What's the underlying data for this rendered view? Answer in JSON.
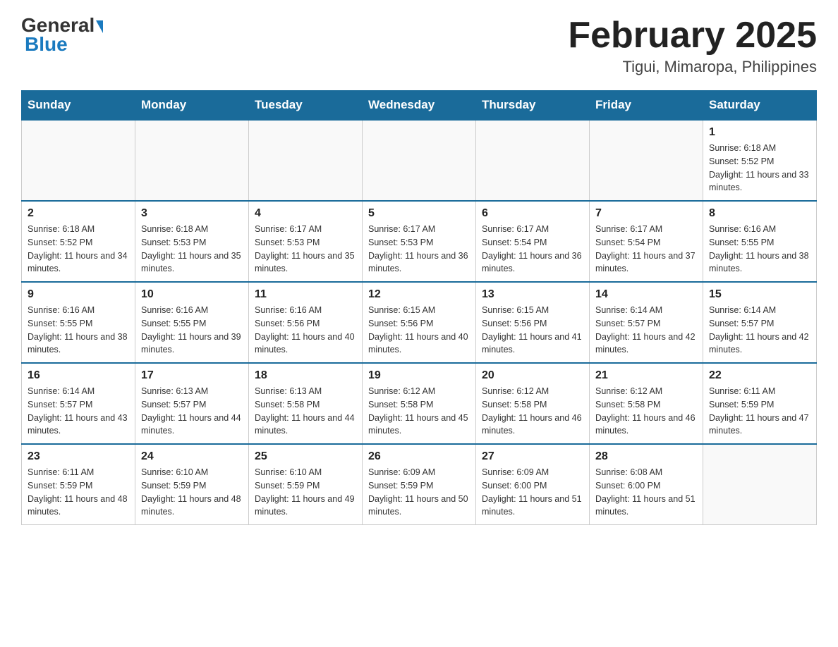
{
  "header": {
    "logo": {
      "general": "General",
      "blue": "Blue"
    },
    "title": "February 2025",
    "location": "Tigui, Mimaropa, Philippines"
  },
  "calendar": {
    "days_of_week": [
      "Sunday",
      "Monday",
      "Tuesday",
      "Wednesday",
      "Thursday",
      "Friday",
      "Saturday"
    ],
    "weeks": [
      {
        "days": [
          {
            "number": "",
            "sunrise": "",
            "sunset": "",
            "daylight": "",
            "empty": true
          },
          {
            "number": "",
            "sunrise": "",
            "sunset": "",
            "daylight": "",
            "empty": true
          },
          {
            "number": "",
            "sunrise": "",
            "sunset": "",
            "daylight": "",
            "empty": true
          },
          {
            "number": "",
            "sunrise": "",
            "sunset": "",
            "daylight": "",
            "empty": true
          },
          {
            "number": "",
            "sunrise": "",
            "sunset": "",
            "daylight": "",
            "empty": true
          },
          {
            "number": "",
            "sunrise": "",
            "sunset": "",
            "daylight": "",
            "empty": true
          },
          {
            "number": "1",
            "sunrise": "Sunrise: 6:18 AM",
            "sunset": "Sunset: 5:52 PM",
            "daylight": "Daylight: 11 hours and 33 minutes.",
            "empty": false
          }
        ]
      },
      {
        "days": [
          {
            "number": "2",
            "sunrise": "Sunrise: 6:18 AM",
            "sunset": "Sunset: 5:52 PM",
            "daylight": "Daylight: 11 hours and 34 minutes.",
            "empty": false
          },
          {
            "number": "3",
            "sunrise": "Sunrise: 6:18 AM",
            "sunset": "Sunset: 5:53 PM",
            "daylight": "Daylight: 11 hours and 35 minutes.",
            "empty": false
          },
          {
            "number": "4",
            "sunrise": "Sunrise: 6:17 AM",
            "sunset": "Sunset: 5:53 PM",
            "daylight": "Daylight: 11 hours and 35 minutes.",
            "empty": false
          },
          {
            "number": "5",
            "sunrise": "Sunrise: 6:17 AM",
            "sunset": "Sunset: 5:53 PM",
            "daylight": "Daylight: 11 hours and 36 minutes.",
            "empty": false
          },
          {
            "number": "6",
            "sunrise": "Sunrise: 6:17 AM",
            "sunset": "Sunset: 5:54 PM",
            "daylight": "Daylight: 11 hours and 36 minutes.",
            "empty": false
          },
          {
            "number": "7",
            "sunrise": "Sunrise: 6:17 AM",
            "sunset": "Sunset: 5:54 PM",
            "daylight": "Daylight: 11 hours and 37 minutes.",
            "empty": false
          },
          {
            "number": "8",
            "sunrise": "Sunrise: 6:16 AM",
            "sunset": "Sunset: 5:55 PM",
            "daylight": "Daylight: 11 hours and 38 minutes.",
            "empty": false
          }
        ]
      },
      {
        "days": [
          {
            "number": "9",
            "sunrise": "Sunrise: 6:16 AM",
            "sunset": "Sunset: 5:55 PM",
            "daylight": "Daylight: 11 hours and 38 minutes.",
            "empty": false
          },
          {
            "number": "10",
            "sunrise": "Sunrise: 6:16 AM",
            "sunset": "Sunset: 5:55 PM",
            "daylight": "Daylight: 11 hours and 39 minutes.",
            "empty": false
          },
          {
            "number": "11",
            "sunrise": "Sunrise: 6:16 AM",
            "sunset": "Sunset: 5:56 PM",
            "daylight": "Daylight: 11 hours and 40 minutes.",
            "empty": false
          },
          {
            "number": "12",
            "sunrise": "Sunrise: 6:15 AM",
            "sunset": "Sunset: 5:56 PM",
            "daylight": "Daylight: 11 hours and 40 minutes.",
            "empty": false
          },
          {
            "number": "13",
            "sunrise": "Sunrise: 6:15 AM",
            "sunset": "Sunset: 5:56 PM",
            "daylight": "Daylight: 11 hours and 41 minutes.",
            "empty": false
          },
          {
            "number": "14",
            "sunrise": "Sunrise: 6:14 AM",
            "sunset": "Sunset: 5:57 PM",
            "daylight": "Daylight: 11 hours and 42 minutes.",
            "empty": false
          },
          {
            "number": "15",
            "sunrise": "Sunrise: 6:14 AM",
            "sunset": "Sunset: 5:57 PM",
            "daylight": "Daylight: 11 hours and 42 minutes.",
            "empty": false
          }
        ]
      },
      {
        "days": [
          {
            "number": "16",
            "sunrise": "Sunrise: 6:14 AM",
            "sunset": "Sunset: 5:57 PM",
            "daylight": "Daylight: 11 hours and 43 minutes.",
            "empty": false
          },
          {
            "number": "17",
            "sunrise": "Sunrise: 6:13 AM",
            "sunset": "Sunset: 5:57 PM",
            "daylight": "Daylight: 11 hours and 44 minutes.",
            "empty": false
          },
          {
            "number": "18",
            "sunrise": "Sunrise: 6:13 AM",
            "sunset": "Sunset: 5:58 PM",
            "daylight": "Daylight: 11 hours and 44 minutes.",
            "empty": false
          },
          {
            "number": "19",
            "sunrise": "Sunrise: 6:12 AM",
            "sunset": "Sunset: 5:58 PM",
            "daylight": "Daylight: 11 hours and 45 minutes.",
            "empty": false
          },
          {
            "number": "20",
            "sunrise": "Sunrise: 6:12 AM",
            "sunset": "Sunset: 5:58 PM",
            "daylight": "Daylight: 11 hours and 46 minutes.",
            "empty": false
          },
          {
            "number": "21",
            "sunrise": "Sunrise: 6:12 AM",
            "sunset": "Sunset: 5:58 PM",
            "daylight": "Daylight: 11 hours and 46 minutes.",
            "empty": false
          },
          {
            "number": "22",
            "sunrise": "Sunrise: 6:11 AM",
            "sunset": "Sunset: 5:59 PM",
            "daylight": "Daylight: 11 hours and 47 minutes.",
            "empty": false
          }
        ]
      },
      {
        "days": [
          {
            "number": "23",
            "sunrise": "Sunrise: 6:11 AM",
            "sunset": "Sunset: 5:59 PM",
            "daylight": "Daylight: 11 hours and 48 minutes.",
            "empty": false
          },
          {
            "number": "24",
            "sunrise": "Sunrise: 6:10 AM",
            "sunset": "Sunset: 5:59 PM",
            "daylight": "Daylight: 11 hours and 48 minutes.",
            "empty": false
          },
          {
            "number": "25",
            "sunrise": "Sunrise: 6:10 AM",
            "sunset": "Sunset: 5:59 PM",
            "daylight": "Daylight: 11 hours and 49 minutes.",
            "empty": false
          },
          {
            "number": "26",
            "sunrise": "Sunrise: 6:09 AM",
            "sunset": "Sunset: 5:59 PM",
            "daylight": "Daylight: 11 hours and 50 minutes.",
            "empty": false
          },
          {
            "number": "27",
            "sunrise": "Sunrise: 6:09 AM",
            "sunset": "Sunset: 6:00 PM",
            "daylight": "Daylight: 11 hours and 51 minutes.",
            "empty": false
          },
          {
            "number": "28",
            "sunrise": "Sunrise: 6:08 AM",
            "sunset": "Sunset: 6:00 PM",
            "daylight": "Daylight: 11 hours and 51 minutes.",
            "empty": false
          },
          {
            "number": "",
            "sunrise": "",
            "sunset": "",
            "daylight": "",
            "empty": true
          }
        ]
      }
    ]
  }
}
